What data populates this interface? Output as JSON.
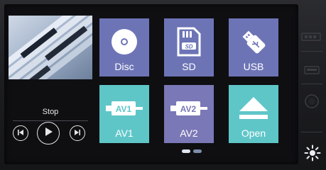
{
  "player": {
    "status": "Stop",
    "controls": {
      "prev_icon": "skip-previous-icon",
      "play_icon": "play-icon",
      "next_icon": "skip-next-icon"
    }
  },
  "sources": [
    {
      "label": "Disc",
      "icon": "disc-icon",
      "color": "#6d74b6"
    },
    {
      "label": "SD",
      "icon": "sd-card-icon",
      "color": "#6d74b6"
    },
    {
      "label": "USB",
      "icon": "usb-icon",
      "color": "#6d74b6"
    },
    {
      "label": "AV1",
      "icon": "av1-plug-icon",
      "badge": "AV1",
      "color": "#5fc6c8"
    },
    {
      "label": "AV2",
      "icon": "av2-plug-icon",
      "badge": "AV2",
      "color": "#7a78b6"
    },
    {
      "label": "Open",
      "icon": "eject-icon",
      "color": "#5fc6c8"
    }
  ],
  "pagination": {
    "pages": 2,
    "current": 1
  },
  "side_panel": {
    "icons": [
      "sd-slot-icon",
      "usb-port-icon",
      "power-knob-icon",
      "brightness-icon"
    ]
  }
}
